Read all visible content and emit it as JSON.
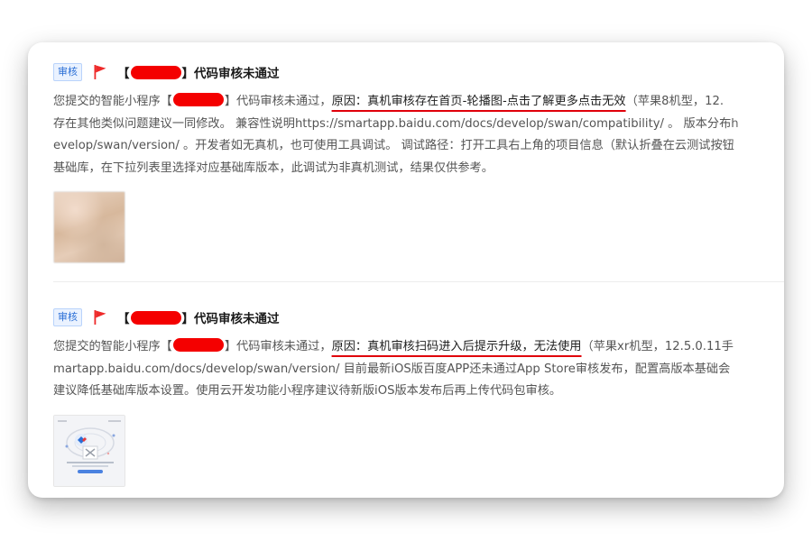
{
  "messages": [
    {
      "tag": "审核",
      "title_open": "【",
      "title_close": "】代码审核未通过",
      "lines": [
        {
          "prefix": "您提交的智能小程序【",
          "after_redact": "】代码审核未通过，",
          "reason": "原因：真机审核存在首页-轮播图-点击了解更多点击无效",
          "suffix": "（苹果8机型，12."
        },
        {
          "text": "存在其他类似问题建议一同修改。 兼容性说明https://smartapp.baidu.com/docs/develop/swan/compatibility/ 。 版本分布h"
        },
        {
          "text": "evelop/swan/version/ 。开发者如无真机，也可使用工具调试。 调试路径：打开工具右上角的项目信息（默认折叠在云测试按钮"
        },
        {
          "text": "基础库，在下拉列表里选择对应基础库版本，此调试为非真机测试，结果仅供参考。"
        }
      ]
    },
    {
      "tag": "审核",
      "title_open": "【",
      "title_close": "】代码审核未通过",
      "lines": [
        {
          "prefix": "您提交的智能小程序【",
          "after_redact": "】代码审核未通过，",
          "reason": "原因：真机审核扫码进入后提示升级，无法使用",
          "suffix": "（苹果xr机型，12.5.0.11手"
        },
        {
          "text": "martapp.baidu.com/docs/develop/swan/version/ 目前最新iOS版百度APP还未通过App Store审核发布，配置高版本基础会"
        },
        {
          "text": "建议降低基础库版本设置。使用云开发功能小程序建议待新版iOS版本发布后再上传代码包审核。"
        }
      ]
    }
  ],
  "colors": {
    "flag": "#ee2a2a",
    "redaction": "#f40000",
    "underline": "#e0000a",
    "tag_text": "#2b6fd6"
  },
  "icons": {
    "flag": "flag-icon"
  }
}
